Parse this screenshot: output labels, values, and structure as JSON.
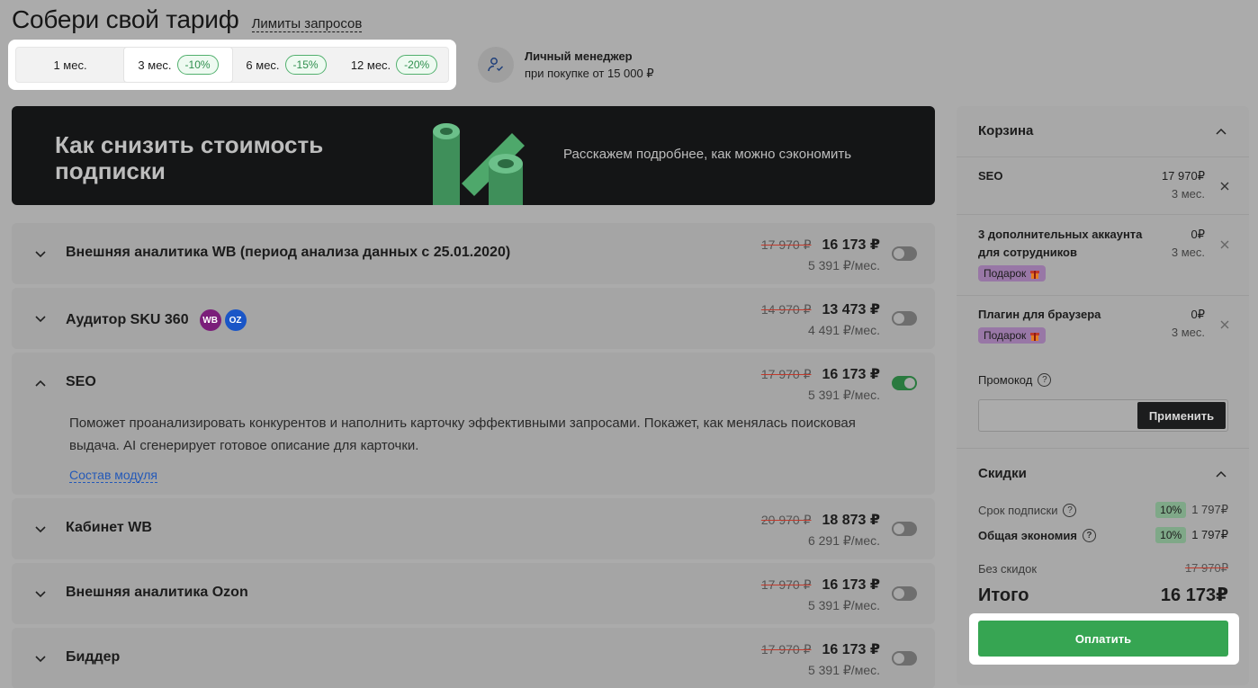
{
  "header": {
    "title": "Собери свой тариф",
    "limits_link": "Лимиты запросов"
  },
  "periods": [
    {
      "label": "1 мес.",
      "badge": ""
    },
    {
      "label": "3 мес.",
      "badge": "-10%"
    },
    {
      "label": "6 мес.",
      "badge": "-15%"
    },
    {
      "label": "12 мес.",
      "badge": "-20%"
    }
  ],
  "manager": {
    "title": "Личный менеджер",
    "subtitle": "при покупке от 15 000 ₽"
  },
  "banner": {
    "title": "Как снизить стоимость подписки",
    "text": "Расскажем подробнее, как можно сэкономить"
  },
  "modules": [
    {
      "name": "Внешняя аналитика WB (период анализа данных с 25.01.2020)",
      "old_price": "17 970 ₽",
      "price": "16 173 ₽",
      "monthly": "5 391 ₽/мес."
    },
    {
      "name": "Аудитор SKU 360",
      "badges": [
        "WB",
        "OZ"
      ],
      "old_price": "14 970 ₽",
      "price": "13 473 ₽",
      "monthly": "4 491 ₽/мес."
    },
    {
      "name": "SEO",
      "old_price": "17 970 ₽",
      "price": "16 173 ₽",
      "monthly": "5 391 ₽/мес.",
      "description": "Поможет проанализировать конкурентов и наполнить карточку эффективными запросами. Покажет, как менялась поисковая выдача. AI сгенерирует готовое описание для карточки.",
      "link": "Состав модуля"
    },
    {
      "name": "Кабинет WB",
      "old_price": "20 970 ₽",
      "price": "18 873 ₽",
      "monthly": "6 291 ₽/мес."
    },
    {
      "name": "Внешняя аналитика Ozon",
      "old_price": "17 970 ₽",
      "price": "16 173 ₽",
      "monthly": "5 391 ₽/мес."
    },
    {
      "name": "Биддер",
      "old_price": "17 970 ₽",
      "price": "16 173 ₽",
      "monthly": "5 391 ₽/мес."
    }
  ],
  "cart": {
    "title": "Корзина",
    "items": [
      {
        "name": "SEO",
        "price": "17 970₽",
        "period": "3 мес."
      },
      {
        "name": "3 дополнительных аккаунта для сотрудников",
        "price": "0₽",
        "period": "3 мес.",
        "gift": "Подарок"
      },
      {
        "name": "Плагин для браузера",
        "price": "0₽",
        "period": "3 мес.",
        "gift": "Подарок"
      }
    ],
    "promo_label": "Промокод",
    "promo_value": "",
    "apply_label": "Применить"
  },
  "discounts": {
    "title": "Скидки",
    "term_label": "Срок подписки",
    "term_pct": "10%",
    "term_value": "1 797₽",
    "total_label": "Общая экономия",
    "total_pct": "10%",
    "total_value": "1 797₽",
    "no_disc_label": "Без скидок",
    "no_disc_value": "17 970₽",
    "sum_label": "Итого",
    "sum_value": "16 173₽",
    "pay_label": "Оплатить"
  }
}
